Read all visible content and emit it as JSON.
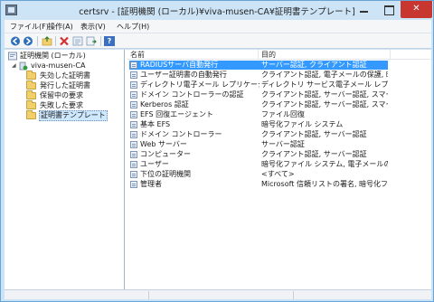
{
  "window": {
    "title": "certsrv - [証明機関 (ローカル)¥viva-musen-CA¥証明書テンプレート]"
  },
  "menu": [
    "ファイル(F)",
    "操作(A)",
    "表示(V)",
    "ヘルプ(H)"
  ],
  "toolbar": {
    "buttons": [
      "back-arrow-icon",
      "forward-arrow-icon",
      "up-folder-icon",
      "delete-icon",
      "properties-icon",
      "export-list-icon",
      "help-icon"
    ],
    "help_label": "?"
  },
  "tree": {
    "root": "証明機関 (ローカル)",
    "ca": "viva-musen-CA",
    "folders": [
      "失効した証明書",
      "発行した証明書",
      "保留中の要求",
      "失敗した要求",
      "証明書テンプレート"
    ]
  },
  "list": {
    "headers": [
      "名前",
      "目的"
    ],
    "rows": [
      {
        "name": "RADIUSサーバ自動発行",
        "purpose": "サーバー認証, クライアント認証"
      },
      {
        "name": "ユーザー証明書の自動発行",
        "purpose": "クライアント認証, 電子メールの保護, 暗号..."
      },
      {
        "name": "ディレクトリ電子メール レプリケーション",
        "purpose": "ディレクトリ サービス電子メール レプリケー..."
      },
      {
        "name": "ドメイン コントローラーの認証",
        "purpose": "クライアント認証, サーバー認証, スマート カ..."
      },
      {
        "name": "Kerberos 認証",
        "purpose": "クライアント認証, サーバー認証, スマート カ..."
      },
      {
        "name": "EFS 回復エージェント",
        "purpose": "ファイル回復"
      },
      {
        "name": "基本 EFS",
        "purpose": "暗号化ファイル システム"
      },
      {
        "name": "ドメイン コントローラー",
        "purpose": "クライアント認証, サーバー認証"
      },
      {
        "name": "Web サーバー",
        "purpose": "サーバー認証"
      },
      {
        "name": "コンピューター",
        "purpose": "クライアント認証, サーバー認証"
      },
      {
        "name": "ユーザー",
        "purpose": "暗号化ファイル システム, 電子メールの保護..."
      },
      {
        "name": "下位の証明機関",
        "purpose": "<すべて>"
      },
      {
        "name": "管理者",
        "purpose": "Microsoft 信頼リストの署名, 暗号化ファ..."
      }
    ]
  },
  "colors": {
    "selection": "#3399ff",
    "close_button": "#c7362f",
    "titlebar": "#cde4f7"
  }
}
